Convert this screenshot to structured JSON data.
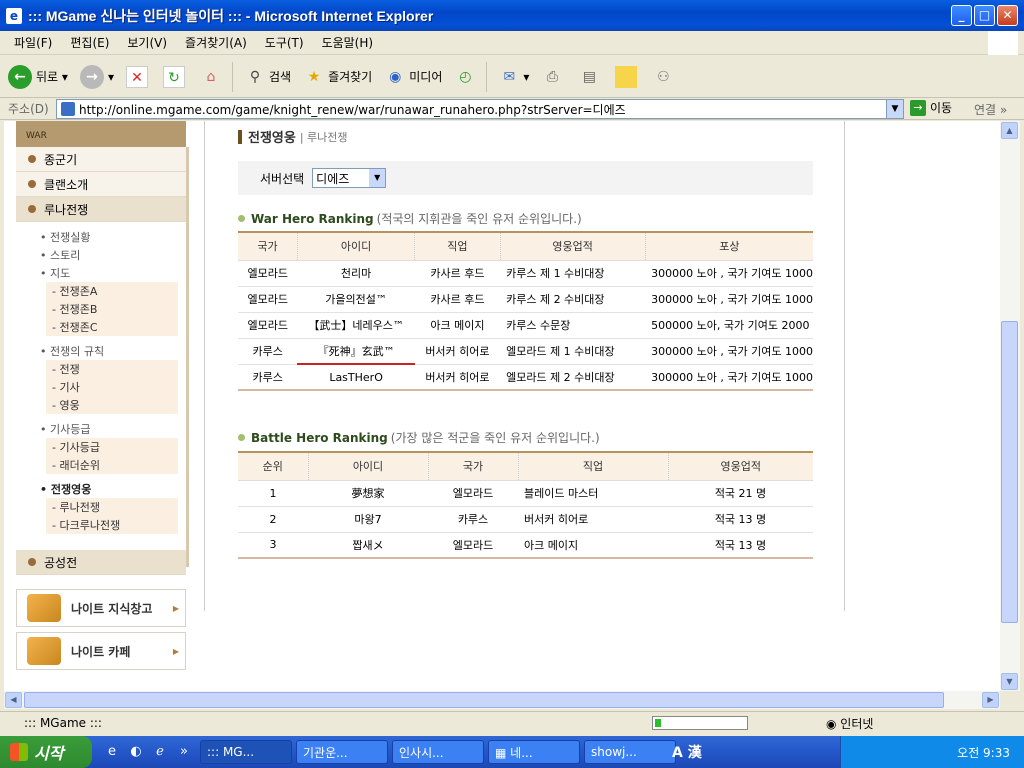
{
  "window": {
    "title": "::: MGame 신나는 인터넷 놀이터 ::: - Microsoft Internet Explorer"
  },
  "menu": [
    "파일(F)",
    "편집(E)",
    "보기(V)",
    "즐겨찾기(A)",
    "도구(T)",
    "도움말(H)"
  ],
  "toolbar": {
    "back": "뒤로",
    "search": "검색",
    "favorites": "즐겨찾기",
    "media": "미디어"
  },
  "address": {
    "label": "주소(D)",
    "url": "http://online.mgame.com/game/knight_renew/war/runawar_runahero.php?strServer=디에즈",
    "go": "이동",
    "links": "연결"
  },
  "sidebar": {
    "header": "WAR",
    "items": [
      "종군기",
      "클랜소개",
      "루나전쟁"
    ],
    "sub": {
      "war_status": "전쟁실황",
      "story": "스토리",
      "map": "지도",
      "map_items": [
        "전쟁존A",
        "전쟁존B",
        "전쟁존C"
      ],
      "rules": "전쟁의 규칙",
      "rules_items": [
        "전쟁",
        "기사",
        "영웅"
      ],
      "knight_rank": "기사등급",
      "knight_rank_items": [
        "기사등급",
        "래더순위"
      ],
      "war_hero": "전쟁영웅",
      "war_hero_items": [
        "루나전쟁",
        "다크루나전쟁"
      ]
    },
    "siege": "공성전",
    "box1": "나이트 지식창고",
    "box2": "나이트 카페"
  },
  "page": {
    "title": "전쟁영웅",
    "subtitle": "루나전쟁",
    "server_label": "서버선택",
    "server_value": "디에즈"
  },
  "war_hero": {
    "title_en": "War Hero Ranking",
    "title_ko": "(적국의 지휘관을 죽인 유저 순위입니다.)",
    "headers": [
      "국가",
      "아이디",
      "직업",
      "영웅업적",
      "포상"
    ],
    "rows": [
      [
        "엘모라드",
        "천리마",
        "카사르 후드",
        "카루스 제 1 수비대장",
        "300000 노아 , 국가 기여도 1000"
      ],
      [
        "엘모라드",
        "가을의전설™",
        "카사르 후드",
        "카루스 제 2 수비대장",
        "300000 노아 , 국가 기여도 1000"
      ],
      [
        "엘모라드",
        "【武士】네레우스™",
        "아크 메이지",
        "카루스 수문장",
        "500000 노아, 국가 기여도 2000"
      ],
      [
        "카루스",
        "『死神』玄武™",
        "버서커 히어로",
        "엘모라드 제 1 수비대장",
        "300000 노아 , 국가 기여도 1000"
      ],
      [
        "카루스",
        "LasTHerO",
        "버서커 히어로",
        "엘모라드 제 2 수비대장",
        "300000 노아 , 국가 기여도 1000"
      ]
    ]
  },
  "battle_hero": {
    "title_en": "Battle Hero Ranking",
    "title_ko": "(가장 많은 적군을 죽인 유저 순위입니다.)",
    "headers": [
      "순위",
      "아이디",
      "국가",
      "직업",
      "영웅업적"
    ],
    "rows": [
      [
        "1",
        "夢想家",
        "엘모라드",
        "블레이드 마스터",
        "적국 21 명"
      ],
      [
        "2",
        "마왕7",
        "카루스",
        "버서커 히어로",
        "적국 13 명"
      ],
      [
        "3",
        "짭새メ",
        "엘모라드",
        "아크 메이지",
        "적국 13 명"
      ]
    ]
  },
  "status": {
    "text": "::: MGame :::",
    "zone": "인터넷"
  },
  "taskbar": {
    "start": "시작",
    "tasks": [
      "::: MG...",
      "기관운...",
      "인사시...",
      "▦ 네...",
      "showj..."
    ],
    "clock": "오전 9:33",
    "ime": "A 漢"
  }
}
